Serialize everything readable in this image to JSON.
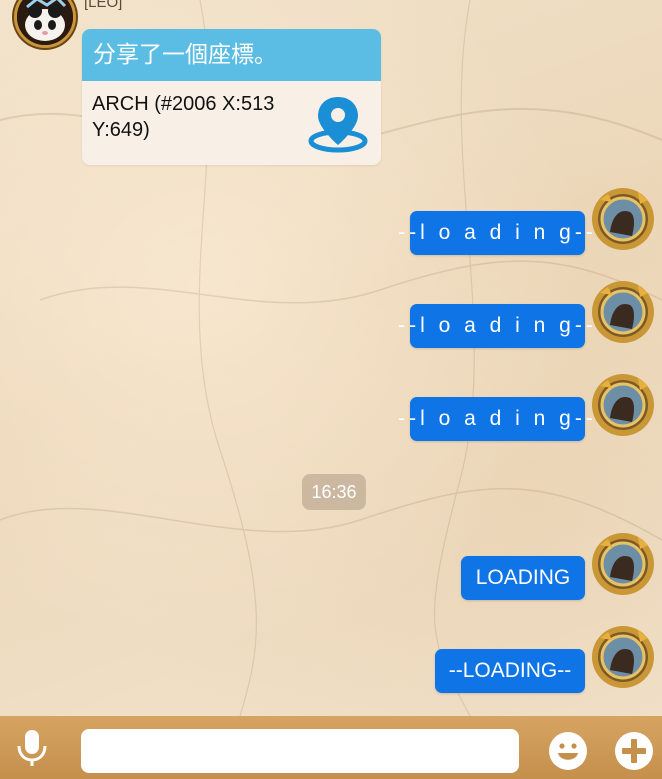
{
  "received": {
    "sender_name": "[LEO] ",
    "location_card": {
      "header": "分享了一個座標。",
      "text_line1": "ARCH (#2006 X:513",
      "text_line2": "Y:649)",
      "icon": "map-pin-icon"
    }
  },
  "sent_messages": [
    {
      "text": "--l o a d i n g--"
    },
    {
      "text": "--l o a d i n g--"
    },
    {
      "text": "--l o a d i n g--"
    },
    {
      "text": "LOADING"
    },
    {
      "text": "--LOADING--"
    }
  ],
  "timestamp": "16:36",
  "input_bar": {
    "placeholder": "",
    "icons": [
      "microphone-icon",
      "emoji-icon",
      "plus-icon"
    ]
  },
  "colors": {
    "sent_bubble": "#0f74e6",
    "card_header": "#5bbde3",
    "input_bar": "#d6a462",
    "pin": "#1a8fd6"
  }
}
